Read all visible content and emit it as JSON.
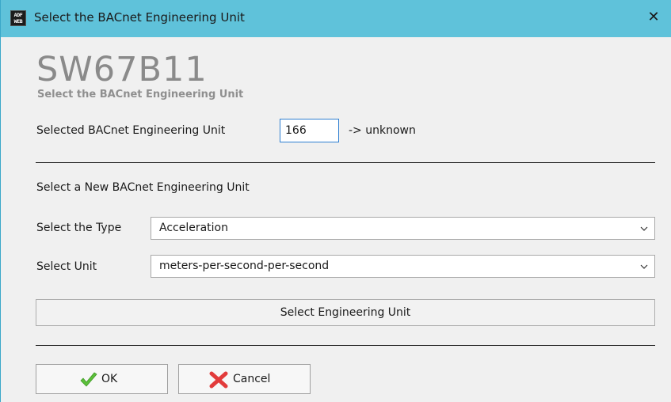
{
  "window": {
    "title": "Select the BACnet Engineering Unit",
    "app_icon_text": [
      "ADF",
      "WEB"
    ],
    "close_glyph": "✕"
  },
  "header": {
    "product_code": "SW67B11",
    "subtitle": "Select the BACnet Engineering Unit"
  },
  "current_unit": {
    "label": "Selected BACnet Engineering Unit",
    "value": "166",
    "resolved": "-> unknown"
  },
  "new_unit": {
    "section_label": "Select a New BACnet Engineering Unit",
    "type_label": "Select the Type",
    "type_value": "Acceleration",
    "unit_label": "Select Unit",
    "unit_value": "meters-per-second-per-second"
  },
  "actions": {
    "select_button": "Select Engineering Unit",
    "ok": "OK",
    "cancel": "Cancel"
  },
  "colors": {
    "titlebar": "#5fc2da",
    "input_border_focus": "#2e7fd1",
    "ok_check": "#5bbf3a",
    "cancel_x": "#e23b3b"
  },
  "icons": {
    "app": "adfweb-logo-icon",
    "close": "close-icon",
    "dropdown": "chevron-down-icon",
    "ok": "checkmark-icon",
    "cancel": "red-x-icon"
  }
}
